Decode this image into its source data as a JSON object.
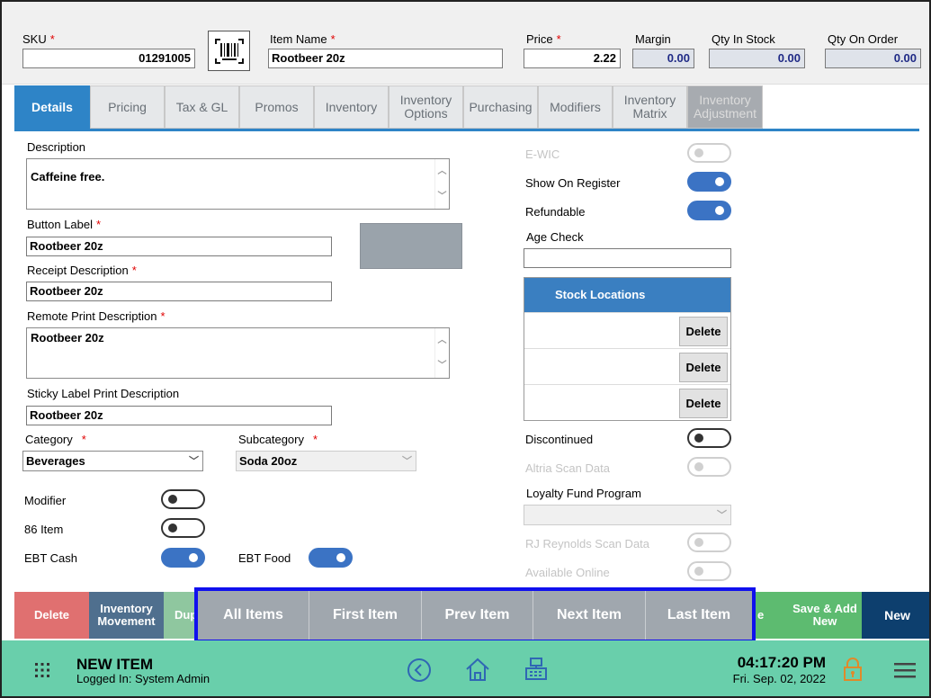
{
  "header": {
    "sku_label": "SKU",
    "sku_value": "01291005",
    "barcode_icon": "barcode-icon",
    "item_name_label": "Item Name",
    "item_name_value": "Rootbeer 20z",
    "price_label": "Price",
    "price_value": "2.22",
    "margin_label": "Margin",
    "margin_value": "0.00",
    "qty_in_stock_label": "Qty In Stock",
    "qty_in_stock_value": "0.00",
    "qty_on_order_label": "Qty On Order",
    "qty_on_order_value": "0.00",
    "required_mark": "*"
  },
  "tabs": [
    {
      "label": "Details"
    },
    {
      "label": "Pricing"
    },
    {
      "label": "Tax & GL"
    },
    {
      "label": "Promos"
    },
    {
      "label": "Inventory"
    },
    {
      "label": "Inventory Options"
    },
    {
      "label": "Purchasing"
    },
    {
      "label": "Modifiers"
    },
    {
      "label": "Inventory Matrix"
    },
    {
      "label": "Inventory Adjustment"
    }
  ],
  "form": {
    "description_label": "Description",
    "description_value": "Caffeine free.",
    "button_label_label": "Button Label",
    "button_label_value": "Rootbeer 20z",
    "receipt_desc_label": "Receipt Description",
    "receipt_desc_value": "Rootbeer 20z",
    "remote_print_label": "Remote Print Description",
    "remote_print_value": "Rootbeer 20z",
    "sticky_label": "Sticky Label Print Description",
    "sticky_value": "Rootbeer 20z",
    "category_label": "Category",
    "category_value": "Beverages",
    "subcategory_label": "Subcategory",
    "subcategory_value": "Soda 20oz",
    "modifier_label": "Modifier",
    "item86_label": "86 Item",
    "ebt_cash_label": "EBT Cash",
    "ebt_food_label": "EBT Food",
    "color_swatch": "#9aa3ab"
  },
  "right": {
    "ewic_label": "E-WIC",
    "show_on_register_label": "Show On Register",
    "refundable_label": "Refundable",
    "age_check_label": "Age Check",
    "age_check_value": "",
    "stock_locations_header": "Stock Locations",
    "delete_label": "Delete",
    "discontinued_label": "Discontinued",
    "altria_label": "Altria Scan Data",
    "loyalty_label": "Loyalty Fund Program",
    "rj_label": "RJ Reynolds Scan Data",
    "available_online_label": "Available Online"
  },
  "actions": {
    "delete": "Delete",
    "inventory_movement": "Inventory Movement",
    "duplicate_partial": "Dup",
    "all_items": "All Items",
    "first_item": "First Item",
    "prev_item": "Prev Item",
    "next_item": "Next Item",
    "last_item": "Last Item",
    "save_partial": "e",
    "save_add_new": "Save & Add New",
    "new": "New"
  },
  "status": {
    "title": "NEW ITEM",
    "logged_in": "Logged In:  System Admin",
    "time": "04:17:20 PM",
    "date": "Fri. Sep. 02, 2022"
  },
  "colors": {
    "accent": "#2e84c7",
    "status_bar": "#69cfab",
    "delete": "#e07070",
    "nav_box": "#1010ee",
    "new_button": "#0d3f6e"
  }
}
